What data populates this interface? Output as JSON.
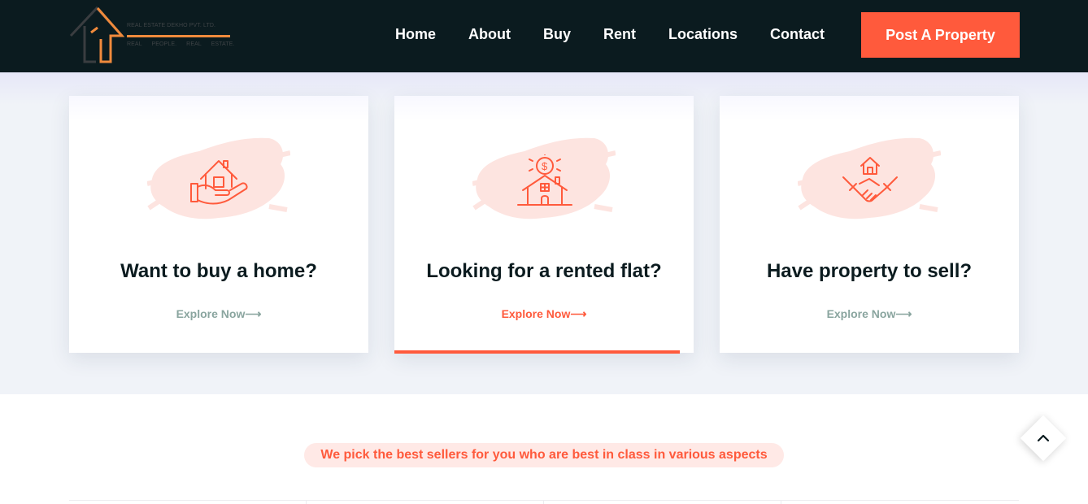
{
  "header": {
    "logo": {
      "company": "REAL ESTATE DEKHO PVT. LTD.",
      "tagline": "REAL PEOPLE. REAL ESTATE."
    },
    "nav": [
      "Home",
      "About",
      "Buy",
      "Rent",
      "Locations",
      "Contact"
    ],
    "cta_label": "Post A Property"
  },
  "cards": [
    {
      "title": "Want to buy a home?",
      "link": "Explore Now",
      "icon": "home-in-hand-icon"
    },
    {
      "title": "Looking for a rented flat?",
      "link": "Explore Now",
      "icon": "house-dollar-icon"
    },
    {
      "title": "Have property to sell?",
      "link": "Explore Now",
      "icon": "handshake-house-icon"
    }
  ],
  "tagline_pill": "We pick the best sellers for you who are best in class in various aspects",
  "colors": {
    "header_bg": "#0b1b1f",
    "accent": "#ff5a3c",
    "muted_link": "#8aa59f",
    "section_bg": "#f0f3f8"
  }
}
